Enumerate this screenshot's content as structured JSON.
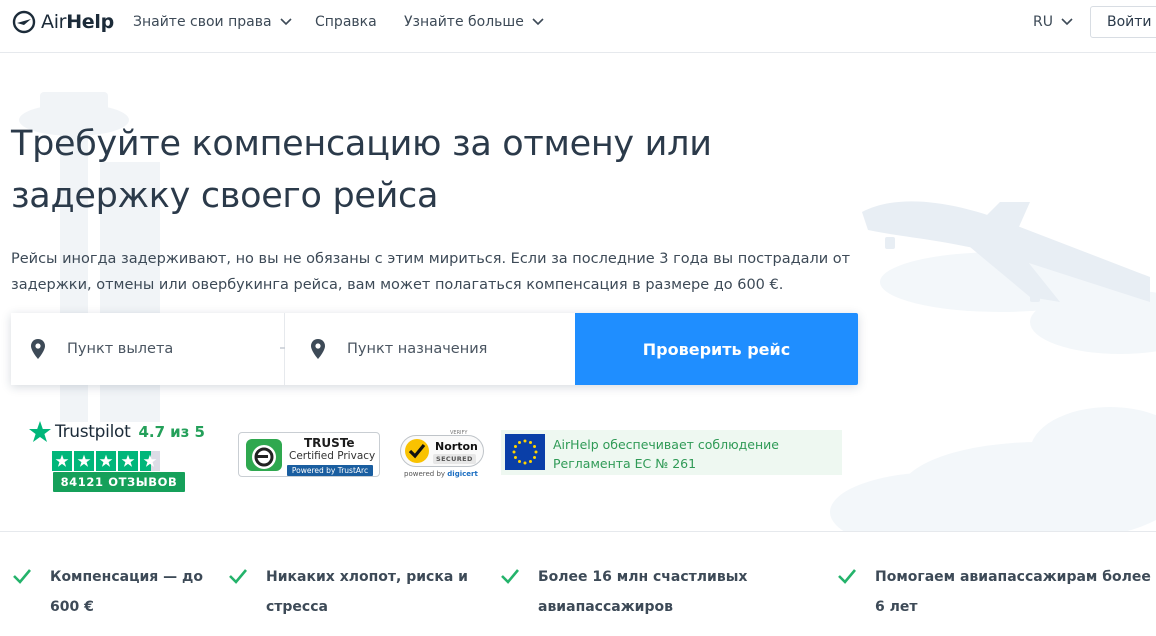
{
  "header": {
    "logo": {
      "name_plain": "Air",
      "name_bold": "Help"
    },
    "nav": [
      {
        "label": "Знайте свои права",
        "has_dropdown": true
      },
      {
        "label": "Справка",
        "has_dropdown": false
      },
      {
        "label": "Узнайте больше",
        "has_dropdown": true
      }
    ],
    "language": "RU",
    "login_label": "Войти"
  },
  "hero": {
    "title": "Требуйте компенсацию за отмену или задержку своего рейса",
    "subtitle": "Рейсы иногда задерживают, но вы не обязаны с этим мириться. Если за последние 3 года вы пострадали от задержки, отмены или овербукинга рейса, вам может полагаться компенсация в размере до 600 €."
  },
  "search": {
    "from_placeholder": "Пункт вылета",
    "to_placeholder": "Пункт назначения",
    "submit_label": "Проверить рейс"
  },
  "trust": {
    "trustpilot": {
      "name": "Trustpilot",
      "score": "4.7",
      "of_text": "из 5",
      "stars": 4.5,
      "reviews": "84121 ОТЗЫВОВ"
    },
    "truste": {
      "title": "TRUSTe",
      "subtitle": "Certified Privacy",
      "powered": "Powered by TrustArc"
    },
    "norton": {
      "verify": "VERIFY",
      "name": "Norton",
      "secured": "SECURED",
      "powered_prefix": "powered by",
      "powered_brand": "digicert"
    },
    "eu": {
      "line1": "AirHelp обеспечивает соблюдение",
      "line2": "Регламента ЕС № 261"
    }
  },
  "benefits": [
    {
      "line1": "Компенсация — до",
      "line2": "600 €"
    },
    {
      "line1": "Никаких хлопот, риска и",
      "line2": "стресса"
    },
    {
      "line1": "Более 16 млн счастливых",
      "line2": "авиапассажиров"
    },
    {
      "line1": "Помогаем авиапассажирам более",
      "line2": "6 лет"
    }
  ],
  "colors": {
    "primary": "#1f8eff",
    "trust_green": "#00b67a",
    "check_green": "#24b36b",
    "text": "#2b3a4a"
  }
}
